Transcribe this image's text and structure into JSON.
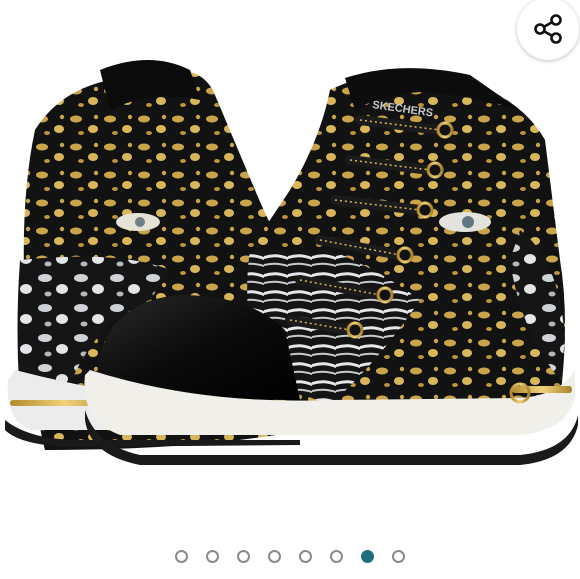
{
  "product_image": {
    "brand_text": "SKECHERS",
    "alt": "Skechers high-top sneakers with gold, black and silver leopard print"
  },
  "share_button": {
    "icon": "share-icon"
  },
  "carousel": {
    "total": 8,
    "active_index": 6,
    "accent_color": "#1f6f7d",
    "inactive_color": "#8a8a8a"
  }
}
